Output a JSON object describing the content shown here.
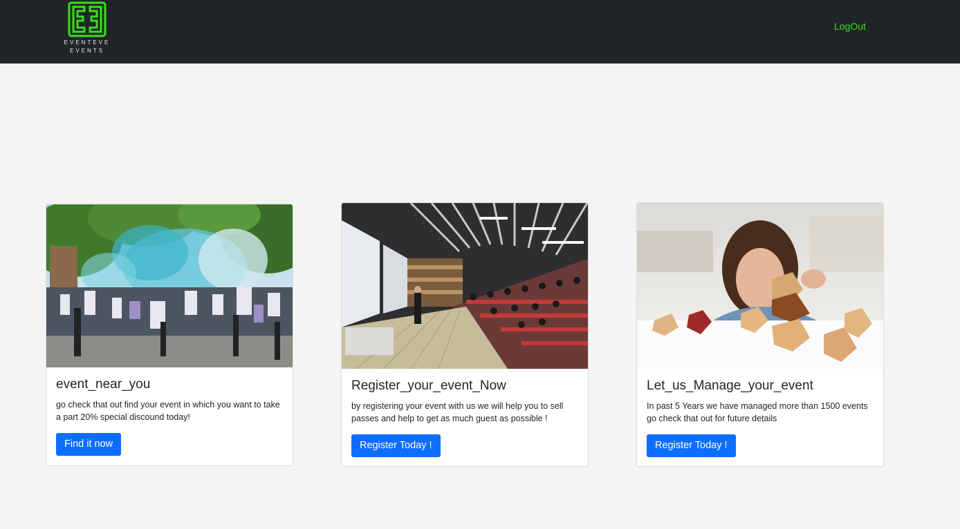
{
  "brand": {
    "line1": "EVENTEVE",
    "line2": "EVENTS",
    "accent_color": "#39e01a"
  },
  "nav": {
    "logout_label": "LogOut"
  },
  "cards": [
    {
      "title": "event_near_you",
      "text": "go check that out find your event in which you want to take a part 20% special discound today!",
      "button_label": "Find it now",
      "image_icon": "crowd-festival-photo"
    },
    {
      "title": "Register_your_event_Now",
      "text": "by registering your event with us we will help you to sell passes and help to get as much guest as possible !",
      "button_label": "Register Today !",
      "image_icon": "lecture-hall-photo"
    },
    {
      "title": "Let_us_Manage_your_event",
      "text": "In past 5 Years we have managed more than 1500 events go check that out for future details",
      "button_label": "Register Today !",
      "image_icon": "child-wooden-blocks-photo"
    }
  ],
  "colors": {
    "navbar_bg": "#212529",
    "page_bg": "#f4f4f4",
    "button_bg": "#0d6efd"
  }
}
